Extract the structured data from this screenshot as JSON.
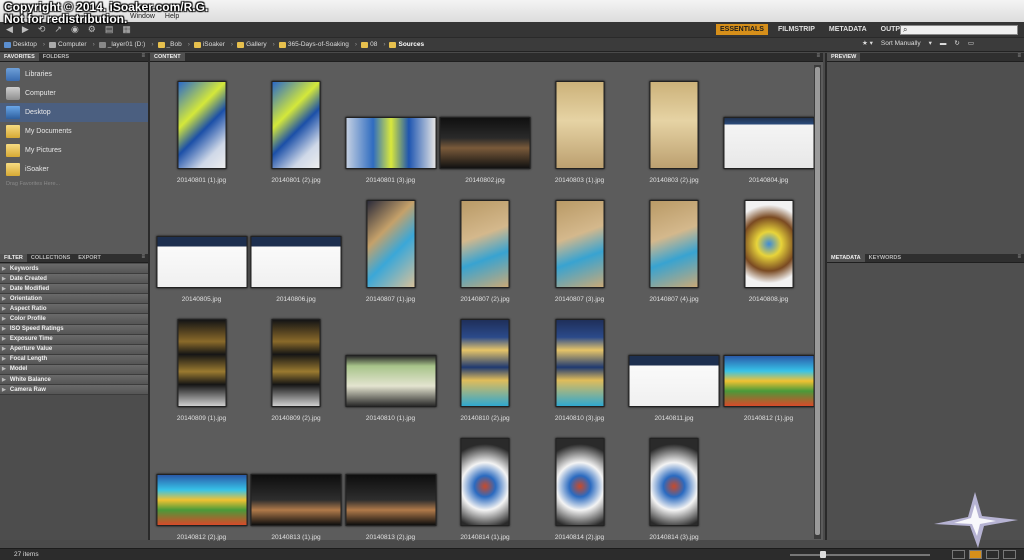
{
  "watermark": {
    "line1": "Copyright © 2014. iSoaker.com/R.G.",
    "line2": "Not for redistribution."
  },
  "menubar": {
    "items": [
      "Window",
      "Help"
    ]
  },
  "workspaces": {
    "items": [
      "ESSENTIALS",
      "FILMSTRIP",
      "METADATA",
      "OUTPUT"
    ],
    "active": "ESSENTIALS"
  },
  "path": {
    "crumbs": [
      "Desktop",
      "Computer",
      "_layer01 (D:)",
      "_Bob",
      "iSoaker",
      "Gallery",
      "365-Days-of-Soaking",
      "08",
      "Sources"
    ],
    "sort_label": "Sort Manually"
  },
  "left_top_tabs": [
    "FAVORITES",
    "FOLDERS"
  ],
  "favorites": [
    {
      "label": "Libraries",
      "icon": "libraries-icon"
    },
    {
      "label": "Computer",
      "icon": "computer-icon"
    },
    {
      "label": "Desktop",
      "icon": "desktop-icon"
    },
    {
      "label": "My Documents",
      "icon": "folder-icon"
    },
    {
      "label": "My Pictures",
      "icon": "folder-icon"
    },
    {
      "label": "iSoaker",
      "icon": "folder-icon"
    }
  ],
  "drag_hint": "Drag Favorites Here...",
  "left_bottom_tabs": [
    "FILTER",
    "COLLECTIONS",
    "EXPORT"
  ],
  "filters": [
    "Keywords",
    "Date Created",
    "Date Modified",
    "Orientation",
    "Aspect Ratio",
    "Color Profile",
    "ISO Speed Ratings",
    "Exposure Time",
    "Aperture Value",
    "Focal Length",
    "Model",
    "White Balance",
    "Camera Raw"
  ],
  "content_tab": "CONTENT",
  "preview_tab": "PREVIEW",
  "right_bottom_tabs": [
    "METADATA",
    "KEYWORDS"
  ],
  "thumbnails": [
    {
      "name": "20140801 (1).jpg",
      "orient": "portrait",
      "fill": "f-toy"
    },
    {
      "name": "20140801 (2).jpg",
      "orient": "portrait",
      "fill": "f-toy"
    },
    {
      "name": "20140801 (3).jpg",
      "orient": "landscape",
      "fill": "f-toyw"
    },
    {
      "name": "20140802.jpg",
      "orient": "landscape",
      "fill": "f-game"
    },
    {
      "name": "20140803 (1).jpg",
      "orient": "portrait",
      "fill": "f-box"
    },
    {
      "name": "20140803 (2).jpg",
      "orient": "portrait",
      "fill": "f-box"
    },
    {
      "name": "20140804.jpg",
      "orient": "landscape",
      "fill": "f-site"
    },
    {
      "name": "20140805.jpg",
      "orient": "landscape",
      "fill": "f-site2"
    },
    {
      "name": "20140806.jpg",
      "orient": "landscape",
      "fill": "f-site2"
    },
    {
      "name": "20140807 (1).jpg",
      "orient": "portrait",
      "fill": "f-boxes"
    },
    {
      "name": "20140807 (2).jpg",
      "orient": "portrait",
      "fill": "f-boxes2"
    },
    {
      "name": "20140807 (3).jpg",
      "orient": "portrait",
      "fill": "f-boxes2"
    },
    {
      "name": "20140807 (4).jpg",
      "orient": "portrait",
      "fill": "f-boxes2"
    },
    {
      "name": "20140808.jpg",
      "orient": "portrait-small",
      "fill": "f-basket"
    },
    {
      "name": "20140809 (1).jpg",
      "orient": "portrait",
      "fill": "f-shelf"
    },
    {
      "name": "20140809 (2).jpg",
      "orient": "portrait",
      "fill": "f-shelf"
    },
    {
      "name": "20140810 (1).jpg",
      "orient": "landscape",
      "fill": "f-screen"
    },
    {
      "name": "20140810 (2).jpg",
      "orient": "portrait",
      "fill": "f-bins"
    },
    {
      "name": "20140810 (3).jpg",
      "orient": "portrait",
      "fill": "f-bins"
    },
    {
      "name": "20140811.jpg",
      "orient": "landscape",
      "fill": "f-site2"
    },
    {
      "name": "20140812 (1).jpg",
      "orient": "landscape",
      "fill": "f-super"
    },
    {
      "name": "20140812 (2).jpg",
      "orient": "landscape",
      "fill": "f-super"
    },
    {
      "name": "20140813 (1).jpg",
      "orient": "landscape",
      "fill": "f-dark"
    },
    {
      "name": "20140813 (2).jpg",
      "orient": "landscape",
      "fill": "f-dark"
    },
    {
      "name": "20140814 (1).jpg",
      "orient": "portrait",
      "fill": "f-bag"
    },
    {
      "name": "20140814 (2).jpg",
      "orient": "portrait",
      "fill": "f-bag"
    },
    {
      "name": "20140814 (3).jpg",
      "orient": "portrait",
      "fill": "f-bag"
    }
  ],
  "status": {
    "item_count": "27 items"
  },
  "colors": {
    "accent": "#d68f1a",
    "panel": "#5c5c5c",
    "selection": "#4b5f80"
  }
}
